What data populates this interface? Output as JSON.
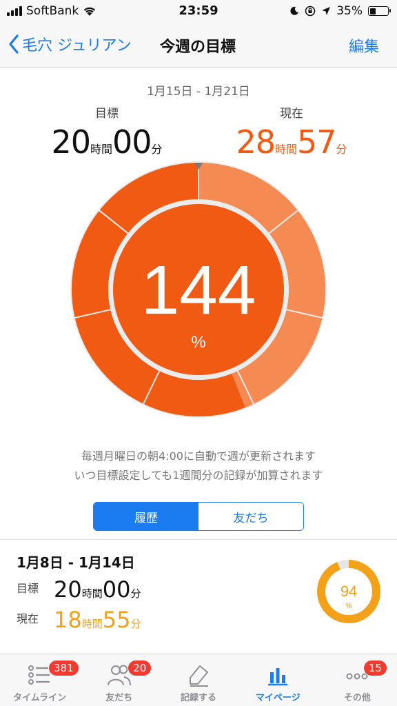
{
  "status_bar": {
    "carrier": "SoftBank",
    "time": "23:59",
    "battery": "35%",
    "battery_level": 0.35
  },
  "nav": {
    "back_label": "毛穴 ジュリアン",
    "title": "今週の目標",
    "edit_label": "編集"
  },
  "week": {
    "range": "1月15日 - 1月21日",
    "goal": {
      "label": "目標",
      "hours": "20",
      "hours_unit": "時間",
      "minutes": "00",
      "minutes_unit": "分"
    },
    "current": {
      "label": "現在",
      "hours": "28",
      "hours_unit": "時間",
      "minutes": "57",
      "minutes_unit": "分"
    },
    "percent_value": "144",
    "percent_sign": "%",
    "progress": 1.44,
    "segments": 7
  },
  "note": {
    "line1": "毎週月曜日の朝4:00に自動で週が更新されます",
    "line2": "いつ目標設定しても1週間分の記録が加算されます"
  },
  "segment_control": {
    "active": "履歴",
    "inactive": "友だち"
  },
  "history": {
    "range": "1月8日 - 1月14日",
    "goal": {
      "label": "目標",
      "hours": "20",
      "hours_unit": "時間",
      "minutes": "00",
      "minutes_unit": "分"
    },
    "current": {
      "label": "現在",
      "hours": "18",
      "hours_unit": "時間",
      "minutes": "55",
      "minutes_unit": "分"
    },
    "percent_value": "94",
    "percent_sign": "%",
    "progress": 0.94
  },
  "tabs": [
    {
      "label": "タイムライン",
      "icon": "list-icon",
      "badge": "381"
    },
    {
      "label": "友だち",
      "icon": "friends-icon",
      "badge": "20"
    },
    {
      "label": "記録する",
      "icon": "pencil-icon",
      "badge": ""
    },
    {
      "label": "マイページ",
      "icon": "bar-chart-icon",
      "badge": ""
    },
    {
      "label": "その他",
      "icon": "more-icon",
      "badge": "15"
    }
  ],
  "colors": {
    "accent": "#1a7cf0",
    "orange": "#f05a12",
    "orange_light": "#f58a52",
    "amber": "#f2a118",
    "badge": "#f23b30"
  }
}
